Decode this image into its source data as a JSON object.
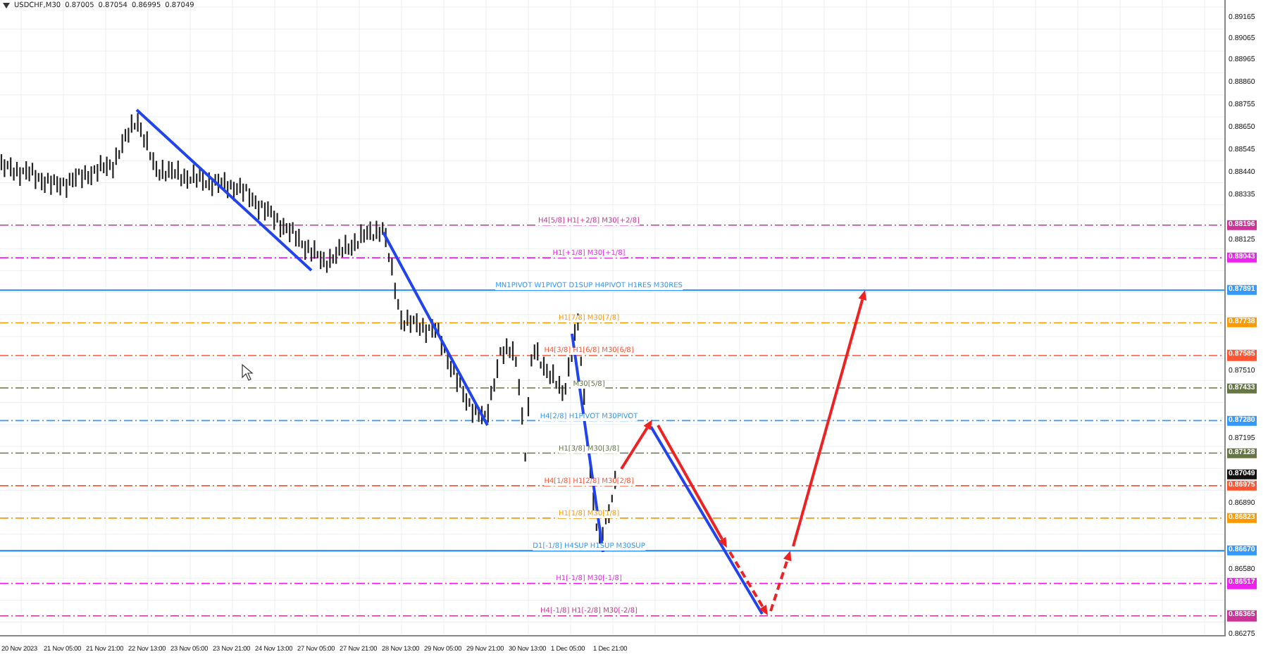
{
  "header": {
    "symbol": "USDCHF,M30",
    "quotes": [
      "0.87005",
      "0.87054",
      "0.86995",
      "0.87049"
    ]
  },
  "levels": [
    {
      "label": "H4[5/8] H1[+2/8] M30[+2/8]",
      "price": "0.88196",
      "color": "#cc3399",
      "kind": "dashed"
    },
    {
      "label": "H1[+1/8] M30[+1/8]",
      "price": "0.88043",
      "color": "#ee22ee",
      "kind": "dashed"
    },
    {
      "label": "MN1PIVOT W1PIVOT D1SUP H4PIVOT H1RES M30RES",
      "price": "0.87891",
      "color": "#3399ff",
      "kind": "solid"
    },
    {
      "label": "H1[7/8] M30[7/8]",
      "price": "0.87738",
      "color": "#ff9900",
      "kind": "dashed"
    },
    {
      "label": "H4[3/8] H1[6/8] M30[6/8]",
      "price": "0.87585",
      "color": "#ff5533",
      "kind": "dashed"
    },
    {
      "label": "M30[5/8]",
      "price": "0.87433",
      "color": "#667744",
      "kind": "dashed"
    },
    {
      "label": "H4[2/8] H1PIVOT M30PIVOT",
      "price": "0.87280",
      "color": "#3399ff",
      "kind": "dashed"
    },
    {
      "label": "H1[3/8] M30[3/8]",
      "price": "0.87128",
      "color": "#667744",
      "kind": "dashed"
    },
    {
      "label": "H4[1/8] H1[2/8] M30[2/8]",
      "price": "0.86975",
      "color": "#ff5533",
      "kind": "dashed"
    },
    {
      "label": "H1[1/8] M30[1/8]",
      "price": "0.86823",
      "color": "#ff9900",
      "kind": "dashed"
    },
    {
      "label": "D1[-1/8] H4SUP H1SUP M30SUP",
      "price": "0.86670",
      "color": "#3399ff",
      "kind": "solid"
    },
    {
      "label": "H1[-1/8] M30[-1/8]",
      "price": "0.86517",
      "color": "#ee22ee",
      "kind": "dashed"
    },
    {
      "label": "H4[-1/8] H1[-2/8] M30[-2/8]",
      "price": "0.86365",
      "color": "#cc3399",
      "kind": "dashed"
    }
  ],
  "current_price": "0.87049",
  "price_axis": [
    "0.89165",
    "0.89065",
    "0.88965",
    "0.88860",
    "0.88755",
    "0.88650",
    "0.88545",
    "0.88440",
    "0.88335",
    "0.88125",
    "0.87510",
    "0.87195",
    "0.86890",
    "0.86580",
    "0.86275"
  ],
  "time_axis": [
    "20 Nov 2023",
    "21 Nov 05:00",
    "21 Nov 21:00",
    "22 Nov 13:00",
    "23 Nov 05:00",
    "23 Nov 21:00",
    "24 Nov 13:00",
    "27 Nov 05:00",
    "27 Nov 21:00",
    "28 Nov 13:00",
    "29 Nov 05:00",
    "29 Nov 21:00",
    "30 Nov 13:00",
    "1 Dec 05:00",
    "1 Dec 21:00"
  ]
}
